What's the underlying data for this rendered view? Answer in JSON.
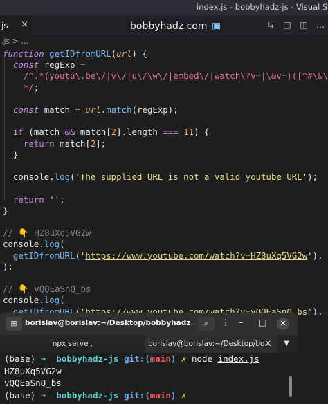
{
  "titlebar": {
    "window_title": "index.js - bobbyhadz-js - Visual Stud"
  },
  "tabbar": {
    "tab_label": "js",
    "tab_close": "×",
    "icons": [
      "⇆",
      "□",
      "◫",
      "…"
    ]
  },
  "badge": {
    "text": "bobbyhadz.com",
    "icon": "▣"
  },
  "breadcrumb": {
    "text": ".js > ..."
  },
  "editor": {
    "lines": [
      [
        {
          "c": "kwi",
          "t": "function "
        },
        {
          "c": "fn",
          "t": "getIDfromURL"
        },
        {
          "c": "pun",
          "t": "("
        },
        {
          "c": "prm",
          "t": "url"
        },
        {
          "c": "pun",
          "t": ") {"
        }
      ],
      [
        {
          "c": "kwi",
          "t": "  const "
        },
        {
          "c": "pun",
          "t": "regExp ="
        }
      ],
      [
        {
          "c": "pun",
          "t": "    "
        },
        {
          "c": "rx",
          "t": "/^.*(youtu\\.be\\/|v\\/|u\\/\\w\\/|embed\\/|watch\\?v=|\\&v=)([^#\\&\\?]*).*"
        }
      ],
      [
        {
          "c": "rx",
          "t": "    */"
        },
        {
          "c": "pun",
          "t": ";"
        }
      ],
      [
        {
          "c": "pun",
          "t": ""
        }
      ],
      [
        {
          "c": "kwi",
          "t": "  const "
        },
        {
          "c": "pun",
          "t": "match = "
        },
        {
          "c": "prm",
          "t": "url"
        },
        {
          "c": "pun",
          "t": "."
        },
        {
          "c": "fn",
          "t": "match"
        },
        {
          "c": "pun",
          "t": "(regExp);"
        }
      ],
      [
        {
          "c": "pun",
          "t": ""
        }
      ],
      [
        {
          "c": "kw",
          "t": "  if "
        },
        {
          "c": "pun",
          "t": "(match "
        },
        {
          "c": "kw",
          "t": "&&"
        },
        {
          "c": "pun",
          "t": " match["
        },
        {
          "c": "num",
          "t": "2"
        },
        {
          "c": "pun",
          "t": "].length "
        },
        {
          "c": "kw",
          "t": "==="
        },
        {
          "c": "pun",
          "t": " "
        },
        {
          "c": "num",
          "t": "11"
        },
        {
          "c": "pun",
          "t": ") {"
        }
      ],
      [
        {
          "c": "kw",
          "t": "    return "
        },
        {
          "c": "pun",
          "t": "match["
        },
        {
          "c": "num",
          "t": "2"
        },
        {
          "c": "pun",
          "t": "];"
        }
      ],
      [
        {
          "c": "pun",
          "t": "  }"
        }
      ],
      [
        {
          "c": "pun",
          "t": ""
        }
      ],
      [
        {
          "c": "pun",
          "t": "  console."
        },
        {
          "c": "fn",
          "t": "log"
        },
        {
          "c": "pun",
          "t": "("
        },
        {
          "c": "str",
          "t": "'The supplied URL is not a valid youtube URL'"
        },
        {
          "c": "pun",
          "t": ");"
        }
      ],
      [
        {
          "c": "pun",
          "t": ""
        }
      ],
      [
        {
          "c": "kw",
          "t": "  return "
        },
        {
          "c": "str",
          "t": "''"
        },
        {
          "c": "pun",
          "t": ";"
        }
      ],
      [
        {
          "c": "pun",
          "t": "}"
        }
      ],
      [
        {
          "c": "pun",
          "t": ""
        }
      ],
      [
        {
          "c": "cmt",
          "t": "// 👇 HZ8uXq5VG2w"
        }
      ],
      [
        {
          "c": "pun",
          "t": "console."
        },
        {
          "c": "fn",
          "t": "log"
        },
        {
          "c": "pun",
          "t": "("
        }
      ],
      [
        {
          "c": "pun",
          "t": "  "
        },
        {
          "c": "fn",
          "t": "getIDfromURL"
        },
        {
          "c": "pun",
          "t": "("
        },
        {
          "c": "str",
          "t": "'"
        },
        {
          "c": "url",
          "t": "https://www.youtube.com/watch?v=HZ8uXq5VG2w"
        },
        {
          "c": "str",
          "t": "'"
        },
        {
          "c": "pun",
          "t": "),"
        }
      ],
      [
        {
          "c": "pun",
          "t": ");"
        }
      ],
      [
        {
          "c": "pun",
          "t": ""
        }
      ],
      [
        {
          "c": "cmt",
          "t": "// 👇 vQQEaSnQ_bs"
        }
      ],
      [
        {
          "c": "pun",
          "t": "console."
        },
        {
          "c": "fn",
          "t": "log"
        },
        {
          "c": "pun",
          "t": "("
        }
      ],
      [
        {
          "c": "pun",
          "t": "  "
        },
        {
          "c": "fn",
          "t": "getIDfromURL"
        },
        {
          "c": "pun",
          "t": "("
        },
        {
          "c": "str",
          "t": "'"
        },
        {
          "c": "url",
          "t": "https://www.youtube.com/watch?v=vQQEaSnQ_bs"
        },
        {
          "c": "str",
          "t": "'"
        },
        {
          "c": "pun",
          "t": "),"
        }
      ],
      [
        {
          "c": "pun",
          "t": ");"
        }
      ]
    ]
  },
  "terminal": {
    "title": "borislav@borislav:~/Desktop/bobbyhadz-r...",
    "new_tab_icon": "⊞",
    "search_icon": "⌕",
    "menu_icon": "⋮",
    "minimize_icon": "–",
    "maximize_icon": "□",
    "close_icon": "✕",
    "tabs": [
      {
        "label": "npx serve ."
      },
      {
        "label": "borislav@borislav:~/Desktop/bo...",
        "close": "✕"
      }
    ],
    "tabs_menu_icon": "▼",
    "lines": [
      [
        {
          "c": "",
          "t": "(base) "
        },
        {
          "c": "t-green",
          "t": "➜ "
        },
        {
          "c": "t-cyan",
          "t": " bobbyhadz-js "
        },
        {
          "c": "t-blue",
          "t": "git:("
        },
        {
          "c": "t-red",
          "t": "main"
        },
        {
          "c": "t-blue",
          "t": ")"
        },
        {
          "c": "t-yellow",
          "t": " ✗ "
        },
        {
          "c": "",
          "t": "node "
        },
        {
          "c": "t-u",
          "t": "index.js"
        }
      ],
      [
        {
          "c": "",
          "t": "HZ8uXq5VG2w"
        }
      ],
      [
        {
          "c": "",
          "t": "vQQEaSnQ_bs"
        }
      ],
      [
        {
          "c": "",
          "t": "(base) "
        },
        {
          "c": "t-green",
          "t": "➜ "
        },
        {
          "c": "t-cyan",
          "t": " bobbyhadz-js "
        },
        {
          "c": "t-blue",
          "t": "git:("
        },
        {
          "c": "t-red",
          "t": "main"
        },
        {
          "c": "t-blue",
          "t": ")"
        },
        {
          "c": "t-yellow",
          "t": " ✗"
        }
      ]
    ]
  }
}
